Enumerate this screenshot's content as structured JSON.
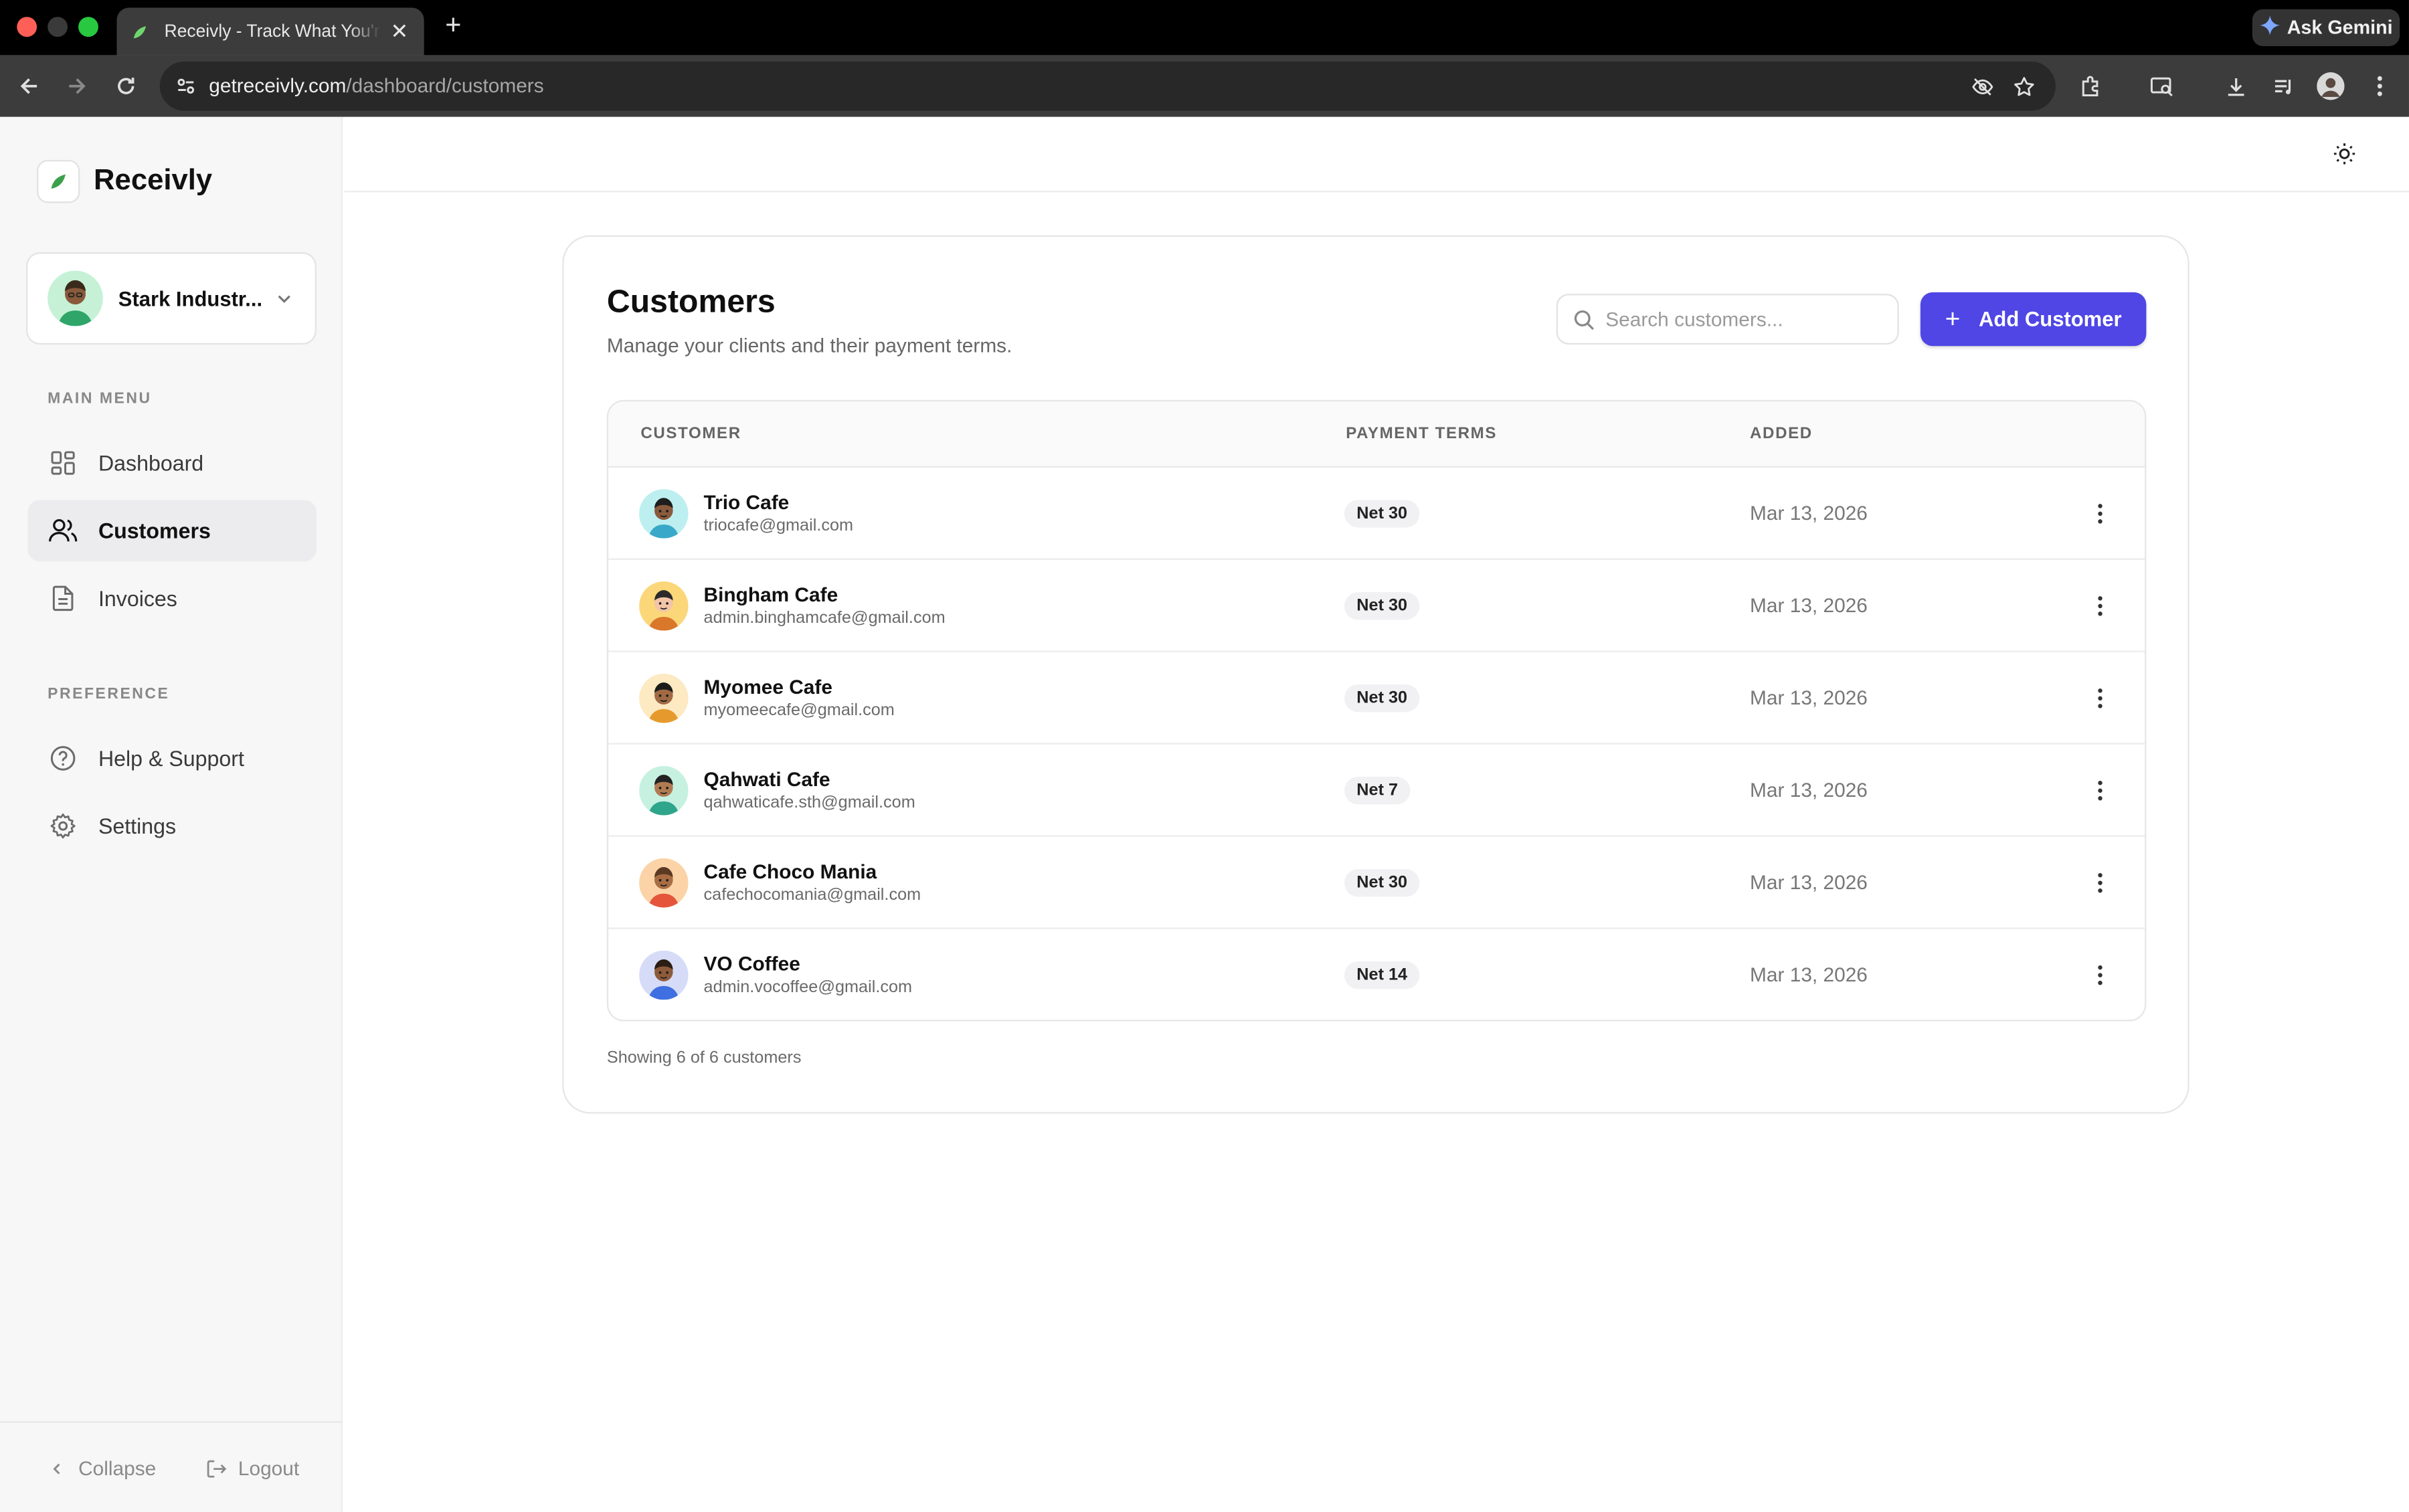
{
  "browser": {
    "tab_title": "Receivly - Track What You're Owed",
    "url_host": "getreceivly.com",
    "url_path": "/dashboard/customers",
    "gemini_label": "Ask Gemini"
  },
  "sidebar": {
    "brand": "Receivly",
    "org_name": "Stark Industr...",
    "main_menu_label": "MAIN MENU",
    "preference_label": "PREFERENCE",
    "items": [
      {
        "label": "Dashboard",
        "icon": "grid-icon"
      },
      {
        "label": "Customers",
        "icon": "users-icon",
        "active": true
      },
      {
        "label": "Invoices",
        "icon": "document-icon"
      }
    ],
    "preference_items": [
      {
        "label": "Help & Support",
        "icon": "help-circle-icon"
      },
      {
        "label": "Settings",
        "icon": "gear-icon"
      }
    ],
    "collapse_label": "Collapse",
    "logout_label": "Logout"
  },
  "main": {
    "title": "Customers",
    "subtitle": "Manage your clients and their payment terms.",
    "search_placeholder": "Search customers...",
    "add_button": "Add Customer",
    "columns": [
      "CUSTOMER",
      "PAYMENT TERMS",
      "ADDED"
    ],
    "customers": [
      {
        "name": "Trio Cafe",
        "email": "triocafe@gmail.com",
        "terms": "Net 30",
        "added": "Mar 13, 2026",
        "avatar_bg": "#bdeff0",
        "shirt": "#3aa9c9",
        "skin": "#8a5a3c",
        "hair": "#1e1e1e"
      },
      {
        "name": "Bingham Cafe",
        "email": "admin.binghamcafe@gmail.com",
        "terms": "Net 30",
        "added": "Mar 13, 2026",
        "avatar_bg": "#fbd77a",
        "shirt": "#d9772b",
        "skin": "#f2c4a8",
        "hair": "#2a2a2a"
      },
      {
        "name": "Myomee Cafe",
        "email": "myomeecafe@gmail.com",
        "terms": "Net 30",
        "added": "Mar 13, 2026",
        "avatar_bg": "#fde9c2",
        "shirt": "#e69a2e",
        "skin": "#a06a44",
        "hair": "#1a1a1a"
      },
      {
        "name": "Qahwati Cafe",
        "email": "qahwaticafe.sth@gmail.com",
        "terms": "Net 7",
        "added": "Mar 13, 2026",
        "avatar_bg": "#c6f1e1",
        "shirt": "#2fa58c",
        "skin": "#b07a52",
        "hair": "#222222"
      },
      {
        "name": "Cafe Choco Mania",
        "email": "cafechocomania@gmail.com",
        "terms": "Net 30",
        "added": "Mar 13, 2026",
        "avatar_bg": "#fcd3a6",
        "shirt": "#e5553c",
        "skin": "#a86d45",
        "hair": "#5b3a22"
      },
      {
        "name": "VO Coffee",
        "email": "admin.vocoffee@gmail.com",
        "terms": "Net 14",
        "added": "Mar 13, 2026",
        "avatar_bg": "#d6dcf7",
        "shirt": "#3f6fe0",
        "skin": "#8d5b3b",
        "hair": "#2b1d14"
      }
    ],
    "showing_text": "Showing 6 of 6 customers"
  },
  "colors": {
    "accent": "#4f46e5",
    "sidebar_bg": "#f7f7f8",
    "active_nav_bg": "#ececee"
  }
}
